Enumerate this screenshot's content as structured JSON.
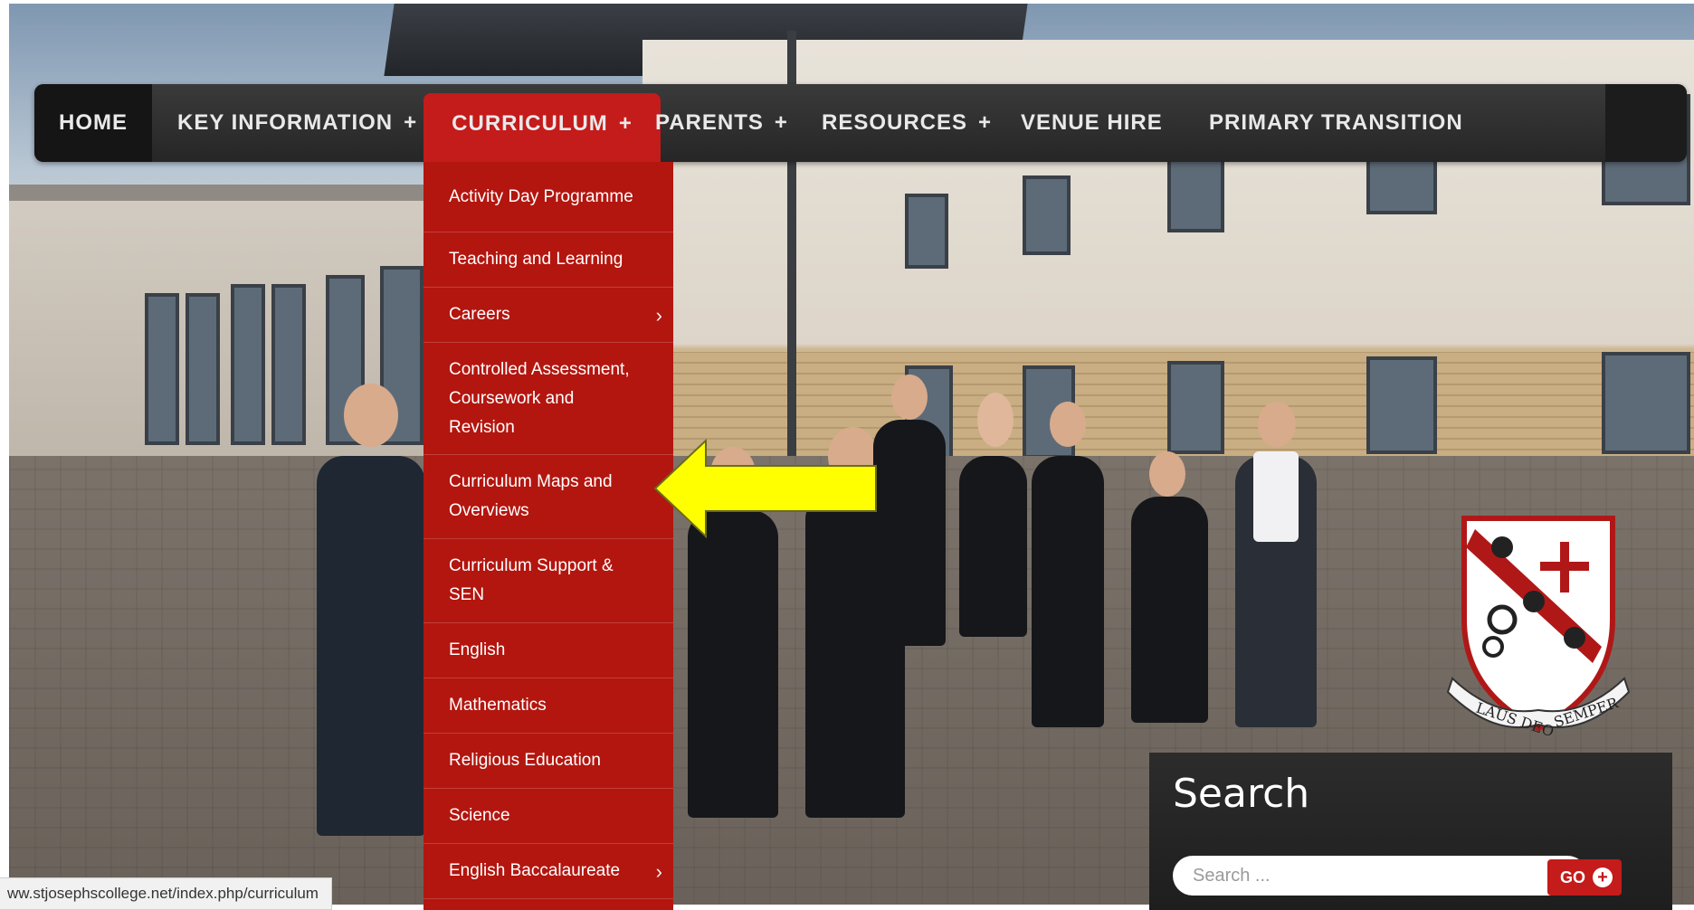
{
  "nav": {
    "home": "HOME",
    "key_information": "KEY INFORMATION",
    "curriculum": "CURRICULUM",
    "parents": "PARENTS",
    "resources": "RESOURCES",
    "venue_hire": "VENUE HIRE",
    "primary_transition": "PRIMARY TRANSITION",
    "plus": "+"
  },
  "dropdown": {
    "items": [
      {
        "label": "Activity Day Programme"
      },
      {
        "label": "Teaching and Learning"
      },
      {
        "label": "Careers",
        "submenu": true
      },
      {
        "label": "Controlled Assessment, Coursework and Revision"
      },
      {
        "label": "Curriculum Maps and Overviews"
      },
      {
        "label": "Curriculum Support & SEN"
      },
      {
        "label": "English"
      },
      {
        "label": "Mathematics"
      },
      {
        "label": "Religious Education"
      },
      {
        "label": "Science"
      },
      {
        "label": "English Baccalaureate",
        "submenu": true
      }
    ],
    "chevron": "›"
  },
  "crest": {
    "motto_left": "LAUS DEO",
    "motto_right": "SEMPER"
  },
  "search": {
    "title": "Search",
    "placeholder": "Search ...",
    "go_label": "GO",
    "go_icon": "+"
  },
  "status": {
    "url": "ww.stjosephscollege.net/index.php/curriculum"
  },
  "colors": {
    "brand_red": "#c41b1b",
    "dropdown_red": "#b3160f",
    "nav_dark": "#2a2a2a",
    "arrow_yellow": "#ffff00"
  }
}
